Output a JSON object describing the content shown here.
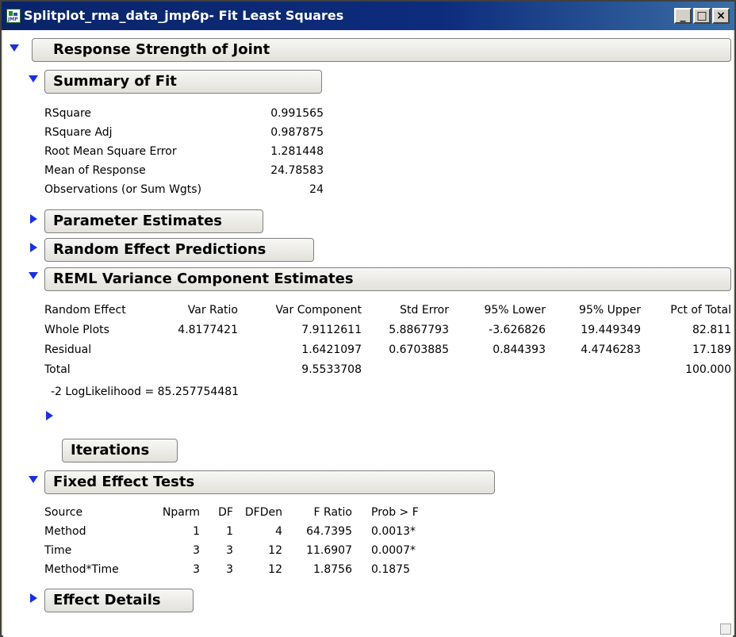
{
  "window": {
    "title": "Splitplot_rma_data_jmp6p- Fit Least Squares",
    "minimize_label": "_",
    "maximize_label": "□",
    "close_label": "×",
    "app_icon_text": "JMP"
  },
  "report": {
    "title": "Response Strength of Joint",
    "summary_of_fit": {
      "title": "Summary of Fit",
      "rows": [
        {
          "label": "RSquare",
          "value": "0.991565"
        },
        {
          "label": "RSquare Adj",
          "value": "0.987875"
        },
        {
          "label": "Root Mean Square Error",
          "value": "1.281448"
        },
        {
          "label": "Mean of Response",
          "value": "24.78583"
        },
        {
          "label": "Observations (or Sum Wgts)",
          "value": "24"
        }
      ]
    },
    "parameter_estimates": {
      "title": "Parameter Estimates"
    },
    "random_effect_predictions": {
      "title": "Random Effect Predictions"
    },
    "reml": {
      "title": "REML Variance Component Estimates",
      "columns": [
        "Random Effect",
        "Var Ratio",
        "Var Component",
        "Std Error",
        "95% Lower",
        "95% Upper",
        "Pct of Total"
      ],
      "rows": [
        [
          "Whole Plots",
          "4.8177421",
          "7.9112611",
          "5.8867793",
          "-3.626826",
          "19.449349",
          "82.811"
        ],
        [
          "Residual",
          "",
          "1.6421097",
          "0.6703885",
          "0.844393",
          "4.4746283",
          "17.189"
        ],
        [
          "Total",
          "",
          "9.5533708",
          "",
          "",
          "",
          "100.000"
        ]
      ],
      "loglik": "-2 LogLikelihood =  85.257754481",
      "iterations_title": "Iterations"
    },
    "fixed_effect_tests": {
      "title": "Fixed Effect Tests",
      "columns": [
        "Source",
        "Nparm",
        "DF",
        "DFDen",
        "F Ratio",
        "Prob > F"
      ],
      "rows": [
        [
          "Method",
          "1",
          "1",
          "4",
          "64.7395",
          "0.0013*"
        ],
        [
          "Time",
          "3",
          "3",
          "12",
          "11.6907",
          "0.0007*"
        ],
        [
          "Method*Time",
          "3",
          "3",
          "12",
          "1.8756",
          "0.1875"
        ]
      ]
    },
    "effect_details": {
      "title": "Effect Details"
    }
  },
  "colors": {
    "titlebar": "#0a246a",
    "disclosure_icon": "#1a2fe0",
    "menu_icon": "#d62020",
    "content_background": "#ffffff"
  }
}
